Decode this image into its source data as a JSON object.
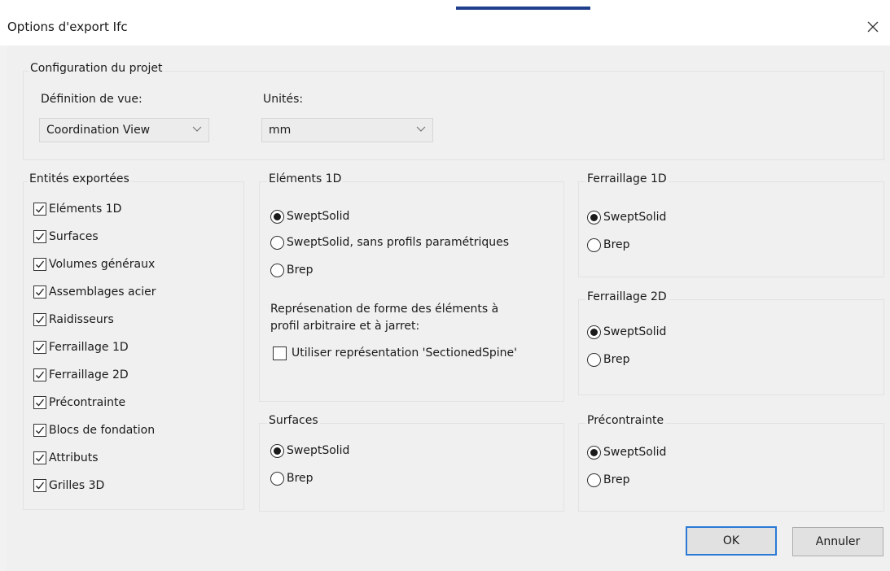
{
  "window": {
    "title": "Options d'export Ifc",
    "close_icon": "close-icon"
  },
  "project_config": {
    "group_label": "Configuration du projet",
    "view_definition": {
      "label": "Définition de vue:",
      "value": "Coordination View"
    },
    "units": {
      "label": "Unités:",
      "value": "mm"
    }
  },
  "exported_entities": {
    "group_label": "Entités exportées",
    "items": [
      {
        "label": "Eléments 1D",
        "checked": true
      },
      {
        "label": "Surfaces",
        "checked": true
      },
      {
        "label": "Volumes généraux",
        "checked": true
      },
      {
        "label": "Assemblages acier",
        "checked": true
      },
      {
        "label": "Raidisseurs",
        "checked": true
      },
      {
        "label": "Ferraillage 1D",
        "checked": true
      },
      {
        "label": "Ferraillage 2D",
        "checked": true
      },
      {
        "label": "Précontrainte",
        "checked": true
      },
      {
        "label": "Blocs de fondation",
        "checked": true
      },
      {
        "label": "Attributs",
        "checked": true
      },
      {
        "label": "Grilles 3D",
        "checked": true
      }
    ]
  },
  "elements_1d": {
    "group_label": "Eléments 1D",
    "options": [
      {
        "label": "SweptSolid",
        "selected": true
      },
      {
        "label": "SweptSolid, sans profils paramétriques",
        "selected": false
      },
      {
        "label": "Brep",
        "selected": false
      }
    ],
    "shape_text_line1": "Représenation de forme des éléments à",
    "shape_text_line2": "profil arbitraire et à jarret:",
    "spine_checkbox": {
      "label": "Utiliser représentation 'SectionedSpine'",
      "checked": false
    }
  },
  "surfaces": {
    "group_label": "Surfaces",
    "options": [
      {
        "label": "SweptSolid",
        "selected": true
      },
      {
        "label": "Brep",
        "selected": false
      }
    ]
  },
  "rebar_1d": {
    "group_label": "Ferraillage 1D",
    "options": [
      {
        "label": "SweptSolid",
        "selected": true
      },
      {
        "label": "Brep",
        "selected": false
      }
    ]
  },
  "rebar_2d": {
    "group_label": "Ferraillage 2D",
    "options": [
      {
        "label": "SweptSolid",
        "selected": true
      },
      {
        "label": "Brep",
        "selected": false
      }
    ]
  },
  "prestress": {
    "group_label": "Précontrainte",
    "options": [
      {
        "label": "SweptSolid",
        "selected": true
      },
      {
        "label": "Brep",
        "selected": false
      }
    ]
  },
  "buttons": {
    "ok": "OK",
    "cancel": "Annuler"
  },
  "colors": {
    "accent": "#2a7ad6",
    "dialog_bg": "#f0f0f0"
  }
}
